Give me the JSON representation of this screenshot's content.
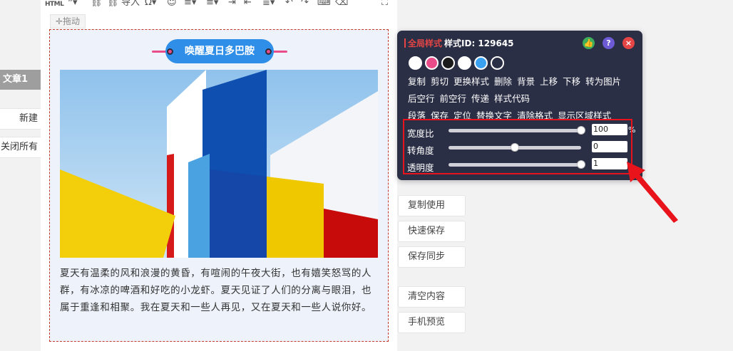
{
  "sidebar": {
    "active_tab": "文章1",
    "new_label": "新建",
    "close_all_label": "关闭所有"
  },
  "toolbar": {
    "html_label": "HTML",
    "import_label": "导入",
    "drag_label": "拖动",
    "drag_icon": "move-icon"
  },
  "article": {
    "title": "唤醒夏日多巴胺",
    "paragraph": "夏天有温柔的风和浪漫的黄昏，有喧闹的午夜大街，也有嬉笑怒骂的人群，有冰凉的啤酒和好吃的小龙虾。夏天见证了人们的分离与眼泪，也属于重逢和相聚。我在夏天和一些人再见，又在夏天和一些人说你好。"
  },
  "panel": {
    "global_label": "全局样式",
    "style_id_label": "样式ID: 129645",
    "swatches": [
      "#ffffff",
      "#e84d8a",
      "#1a1a1a",
      "#ffffff",
      "#3aa0f0",
      "#2b2f45"
    ],
    "actions_row1": [
      "复制",
      "剪切",
      "更换样式",
      "删除",
      "背景",
      "上移",
      "下移",
      "转为图片"
    ],
    "actions_row2": [
      "后空行",
      "前空行",
      "传递",
      "样式代码"
    ],
    "actions_row3": [
      "段落",
      "保存",
      "定位",
      "替换文字",
      "清除格式",
      "显示区域样式"
    ],
    "sliders": [
      {
        "label": "宽度比",
        "value": "100",
        "unit": "%",
        "fraction": 1.0
      },
      {
        "label": "转角度",
        "value": "0",
        "unit": "",
        "fraction": 0.5
      },
      {
        "label": "透明度",
        "value": "1",
        "unit": "",
        "fraction": 1.0
      }
    ],
    "colors": {
      "accent_red": "#e64545",
      "green_icon": "#3dae5c",
      "help_icon": "#6c5bd4",
      "close_icon": "#e64545"
    }
  },
  "side_buttons": [
    "复制使用",
    "快速保存",
    "保存同步",
    "清空内容",
    "手机预览"
  ]
}
